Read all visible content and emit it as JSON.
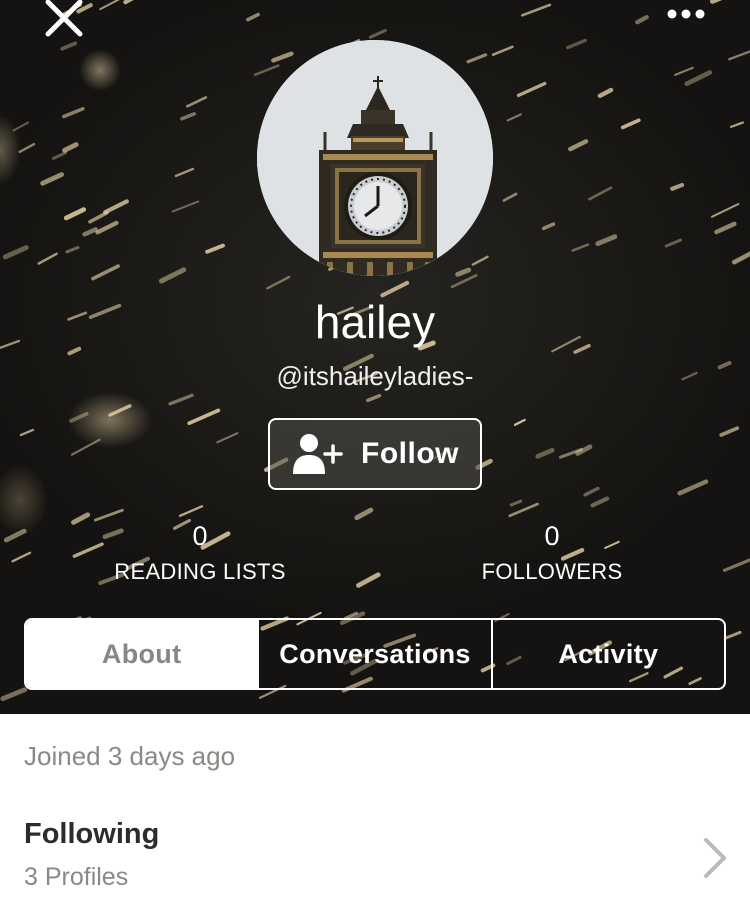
{
  "profile": {
    "display_name": "hailey",
    "handle": "@itshaileyladies-"
  },
  "header": {
    "close_icon": "close-icon",
    "more_icon": "more-horizontal-icon",
    "avatar_subject": "clock-tower"
  },
  "follow_button": {
    "label": "Follow",
    "icon": "add-user-icon"
  },
  "stats": {
    "reading_lists": {
      "count": "0",
      "label": "READING LISTS"
    },
    "followers": {
      "count": "0",
      "label": "FOLLOWERS"
    }
  },
  "tabs": [
    {
      "label": "About",
      "active": true
    },
    {
      "label": "Conversations",
      "active": false
    },
    {
      "label": "Activity",
      "active": false
    }
  ],
  "about": {
    "joined": "Joined 3 days ago",
    "following": {
      "title": "Following",
      "subtitle": "3 Profiles",
      "icon": "chevron-right-icon"
    }
  },
  "colors": {
    "header_bg": "#1b1a18",
    "active_tab_text": "#8a8682",
    "muted_text": "#8c8884",
    "dark_text": "#2e2c2a"
  }
}
